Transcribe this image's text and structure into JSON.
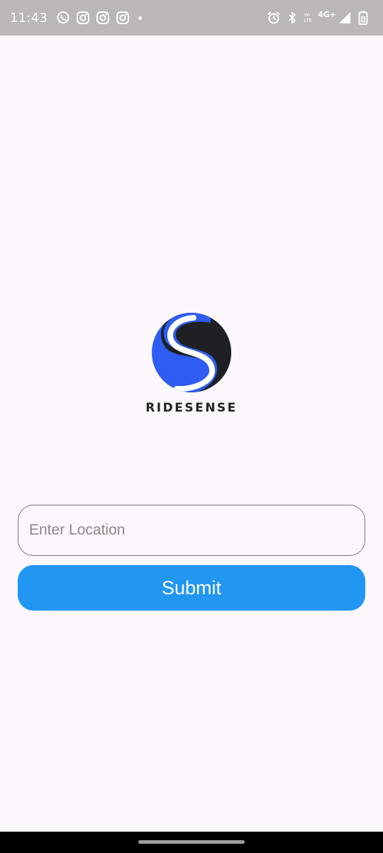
{
  "status_bar": {
    "time": "11:43",
    "left_icons": [
      "whatsapp-icon",
      "instagram-icon",
      "instagram-icon",
      "instagram-icon",
      "dot-icon"
    ],
    "right_icons": [
      "alarm-icon",
      "bluetooth-icon",
      "volte-icon",
      "signal-icon",
      "battery-icon"
    ],
    "volte_top": "Vo",
    "volte_bottom": "LTE",
    "network": "4G+"
  },
  "brand": {
    "name": "RIDESENSE",
    "colors": {
      "blue": "#2f5cf2",
      "dark": "#1e2024"
    }
  },
  "form": {
    "location_placeholder": "Enter Location",
    "location_value": "",
    "submit_label": "Submit"
  },
  "colors": {
    "background": "#fcf7fc",
    "accent": "#2196f3",
    "status_bar": "#bab6ba"
  }
}
